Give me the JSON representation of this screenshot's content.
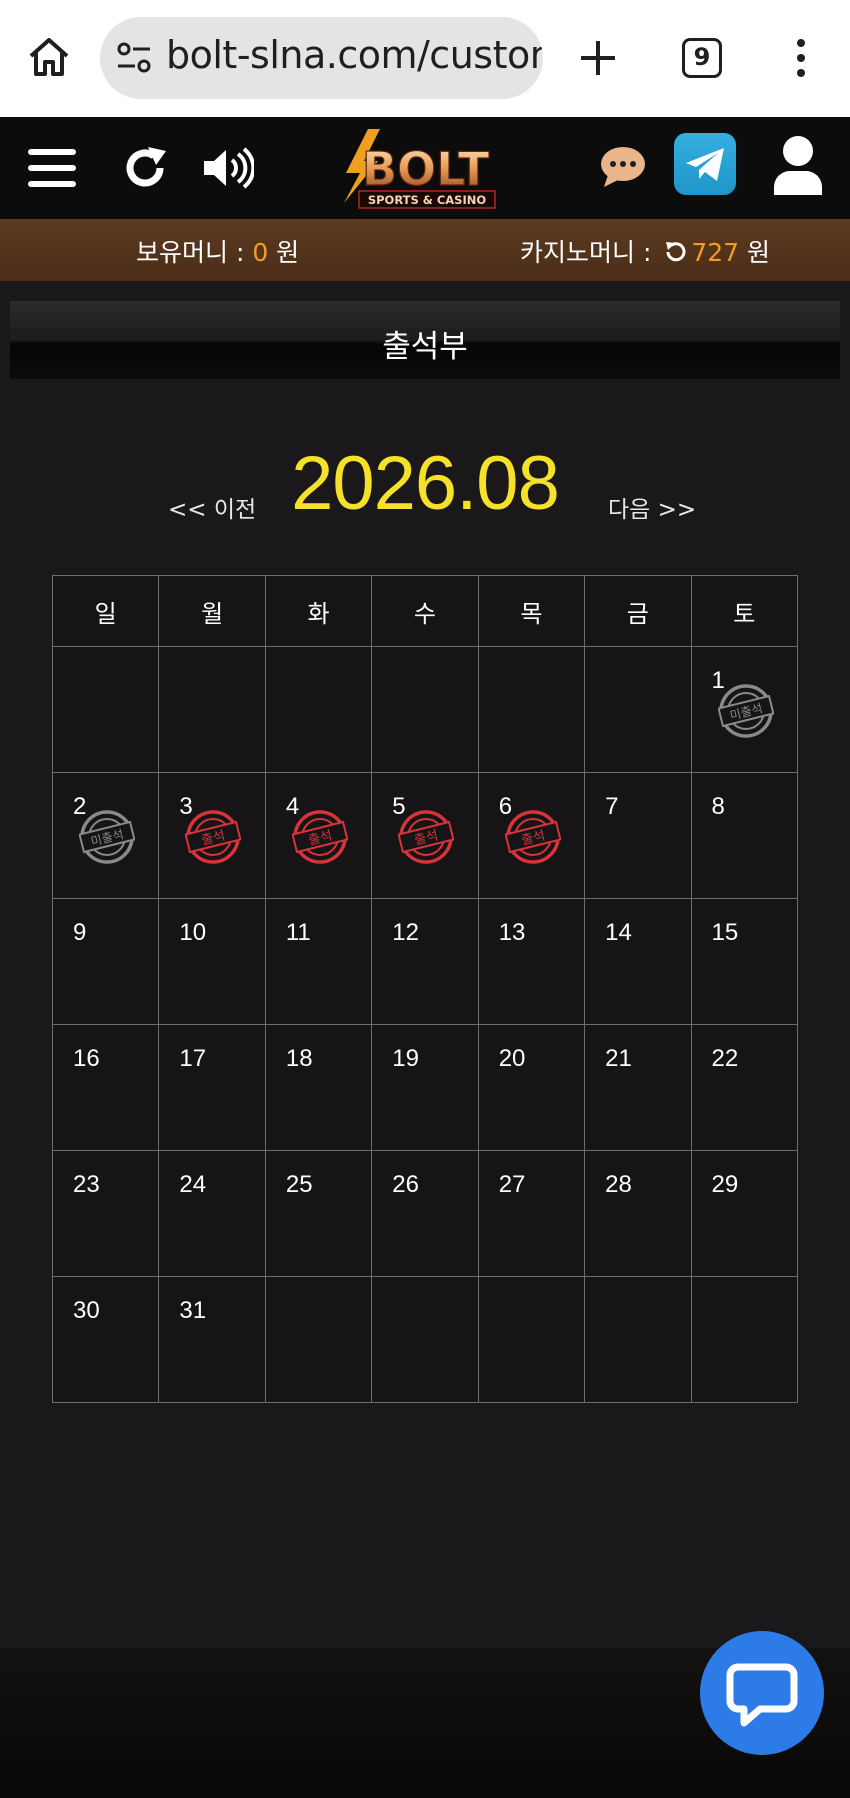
{
  "browser": {
    "url": "bolt-slna.com/custom",
    "tab_count": "9"
  },
  "header": {
    "logo_text": "BOLT",
    "logo_subtext": "SPORTS & CASINO"
  },
  "money": {
    "holding_label": "보유머니 : ",
    "holding_amount": "0",
    "holding_unit": " 원",
    "casino_label": "카지노머니 : ",
    "casino_amount": "727",
    "casino_unit": " 원"
  },
  "page": {
    "title": "출석부"
  },
  "calendar": {
    "prev_label": "<< 이전",
    "next_label": "다음 >>",
    "month": "2026.08",
    "weekdays": [
      "일",
      "월",
      "화",
      "수",
      "목",
      "금",
      "토"
    ],
    "weeks": [
      [
        "",
        "",
        "",
        "",
        "",
        "",
        "1"
      ],
      [
        "2",
        "3",
        "4",
        "5",
        "6",
        "7",
        "8"
      ],
      [
        "9",
        "10",
        "11",
        "12",
        "13",
        "14",
        "15"
      ],
      [
        "16",
        "17",
        "18",
        "19",
        "20",
        "21",
        "22"
      ],
      [
        "23",
        "24",
        "25",
        "26",
        "27",
        "28",
        "29"
      ],
      [
        "30",
        "31",
        "",
        "",
        "",
        "",
        ""
      ]
    ],
    "stamps": {
      "1": "미출석",
      "2": "미출석",
      "3": "출석",
      "4": "출석",
      "5": "출석",
      "6": "출석"
    },
    "colors": {
      "attended": "#d7343a",
      "absent": "#8a8a8a"
    }
  }
}
